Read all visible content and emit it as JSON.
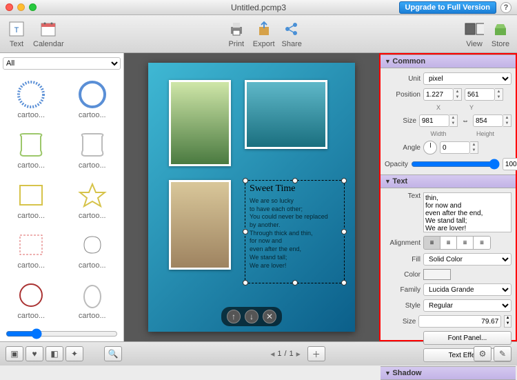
{
  "window": {
    "title": "Untitled.pcmp3"
  },
  "titlebar": {
    "upgrade": "Upgrade to Full Version",
    "help": "?"
  },
  "toolbar": {
    "left": [
      {
        "id": "text",
        "label": "Text"
      },
      {
        "id": "calendar",
        "label": "Calendar"
      }
    ],
    "center": [
      {
        "id": "print",
        "label": "Print"
      },
      {
        "id": "export",
        "label": "Export"
      },
      {
        "id": "share",
        "label": "Share"
      }
    ],
    "right": [
      {
        "id": "view",
        "label": "View"
      },
      {
        "id": "store",
        "label": "Store"
      }
    ]
  },
  "sidebar": {
    "filter": {
      "options": [
        "All"
      ],
      "selected": "All"
    },
    "shapes": [
      {
        "label": "cartoo..."
      },
      {
        "label": "cartoo..."
      },
      {
        "label": "cartoo..."
      },
      {
        "label": "cartoo..."
      },
      {
        "label": "cartoo..."
      },
      {
        "label": "cartoo..."
      },
      {
        "label": "cartoo..."
      },
      {
        "label": "cartoo..."
      },
      {
        "label": "cartoo..."
      },
      {
        "label": "cartoo..."
      }
    ]
  },
  "canvas": {
    "textbox_title": "Sweet Time",
    "textbox_body": "We are so lucky\nto have each other;\nYou could never be replaced\nby another.\nThrough thick and thin,\nfor now and\neven after the end,\nWe stand tall;\nWe are lover!"
  },
  "inspector": {
    "common": {
      "header": "Common",
      "unit_label": "Unit",
      "unit": "pixel",
      "position_label": "Position",
      "pos_x": "1.227",
      "pos_y": "561",
      "x_label": "X",
      "y_label": "Y",
      "size_label": "Size",
      "width": "981",
      "height": "854",
      "width_label": "Width",
      "height_label": "Height",
      "angle_label": "Angle",
      "angle": "0",
      "opacity_label": "Opacity",
      "opacity": "100"
    },
    "text": {
      "header": "Text",
      "text_label": "Text",
      "text": "thin,\nfor now and\neven after the end,\nWe stand tall;\nWe are lover!",
      "alignment_label": "Alignment",
      "fill_label": "Fill",
      "fill": "Solid Color",
      "color_label": "Color",
      "family_label": "Family",
      "family": "Lucida Grande",
      "style_label": "Style",
      "style": "Regular",
      "size_label": "Size",
      "size": "79.67",
      "font_panel_btn": "Font Panel...",
      "text_effect_btn": "Text Effect..."
    },
    "shadow": {
      "header": "Shadow"
    }
  },
  "bottombar": {
    "page_current": "1",
    "page_total": "1"
  }
}
